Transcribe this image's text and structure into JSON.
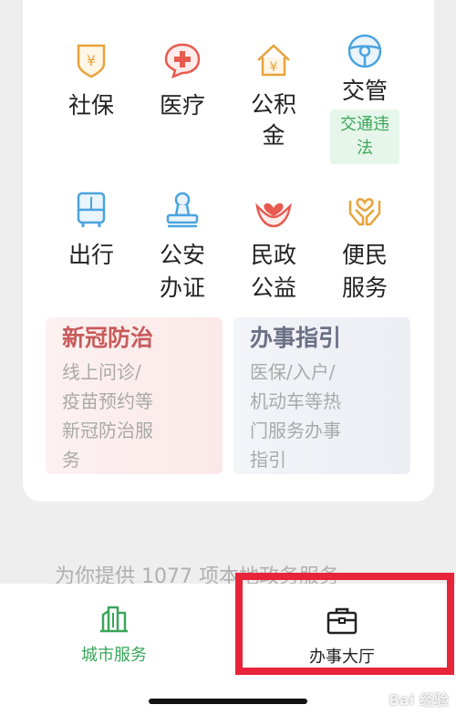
{
  "services": [
    {
      "label": "社保",
      "icon": "social-security-shield-icon",
      "color": "#e8a33c"
    },
    {
      "label": "医疗",
      "icon": "medical-cross-bubble-icon",
      "color": "#e85a4f"
    },
    {
      "label": "公积\n金",
      "icon": "housing-fund-house-icon",
      "color": "#e8a33c"
    },
    {
      "label": "交管",
      "icon": "steering-wheel-icon",
      "color": "#4aa3df",
      "badge": "交通违\n法"
    },
    {
      "label": "出行",
      "icon": "bus-icon",
      "color": "#4aa3df"
    },
    {
      "label": "公安\n办证",
      "icon": "police-stamp-icon",
      "color": "#4aa3df"
    },
    {
      "label": "民政\n公益",
      "icon": "heart-flower-icon",
      "color": "#e85a4f"
    },
    {
      "label": "便民\n服务",
      "icon": "heart-hands-icon",
      "color": "#e8a33c"
    }
  ],
  "panels": {
    "covid": {
      "title": "新冠防治",
      "desc": "线上问诊/\n疫苗预约等\n新冠防治服\n务"
    },
    "guide": {
      "title": "办事指引",
      "desc": "医保/入户/\n机动车等热\n门服务办事\n指引"
    }
  },
  "footer_text": "为你提供 1077 项本地政务服务",
  "tabs": {
    "city": {
      "label": "城市服务",
      "icon": "city-buildings-icon",
      "color": "#3aa65a"
    },
    "hall": {
      "label": "办事大厅",
      "icon": "briefcase-icon",
      "color": "#222222"
    }
  },
  "watermark": "Bai 经验",
  "colors": {
    "highlight": "#e8243a",
    "accent_green": "#3aa65a"
  }
}
